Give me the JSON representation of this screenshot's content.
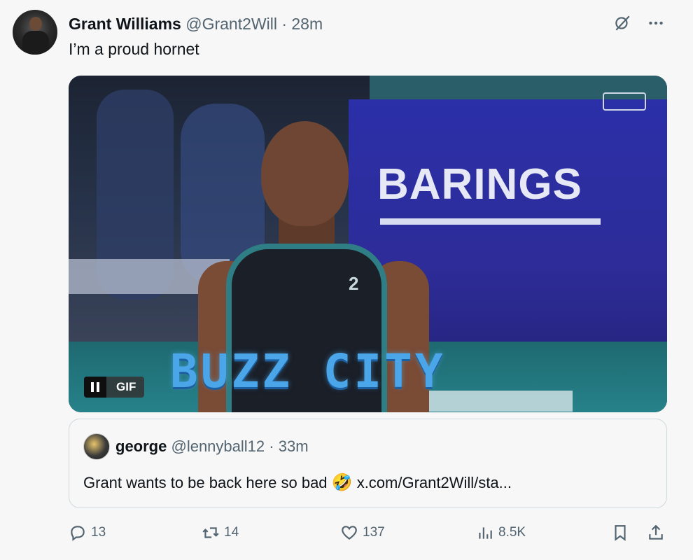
{
  "tweet": {
    "author_name": "Grant Williams",
    "handle": "@Grant2Will",
    "separator": "·",
    "time": "28m",
    "text": "I’m a proud hornet",
    "media": {
      "banner_text": "BARINGS",
      "overlay_text": "BUZZ CITY",
      "jersey_number": "2",
      "badge_label": "GIF"
    }
  },
  "quote": {
    "author_name": "george",
    "handle": "@lennyball12",
    "separator": "·",
    "time": "33m",
    "text": "Grant wants to be back here so bad",
    "emoji": "🤣",
    "link": "x.com/Grant2Will/sta..."
  },
  "actions": {
    "replies": "13",
    "reposts": "14",
    "likes": "137",
    "views": "8.5K"
  },
  "icons": {
    "top_right": [
      "grok-icon",
      "more-icon"
    ],
    "action_bar": [
      "reply-icon",
      "repost-icon",
      "like-icon",
      "views-icon",
      "bookmark-icon",
      "share-icon"
    ]
  }
}
